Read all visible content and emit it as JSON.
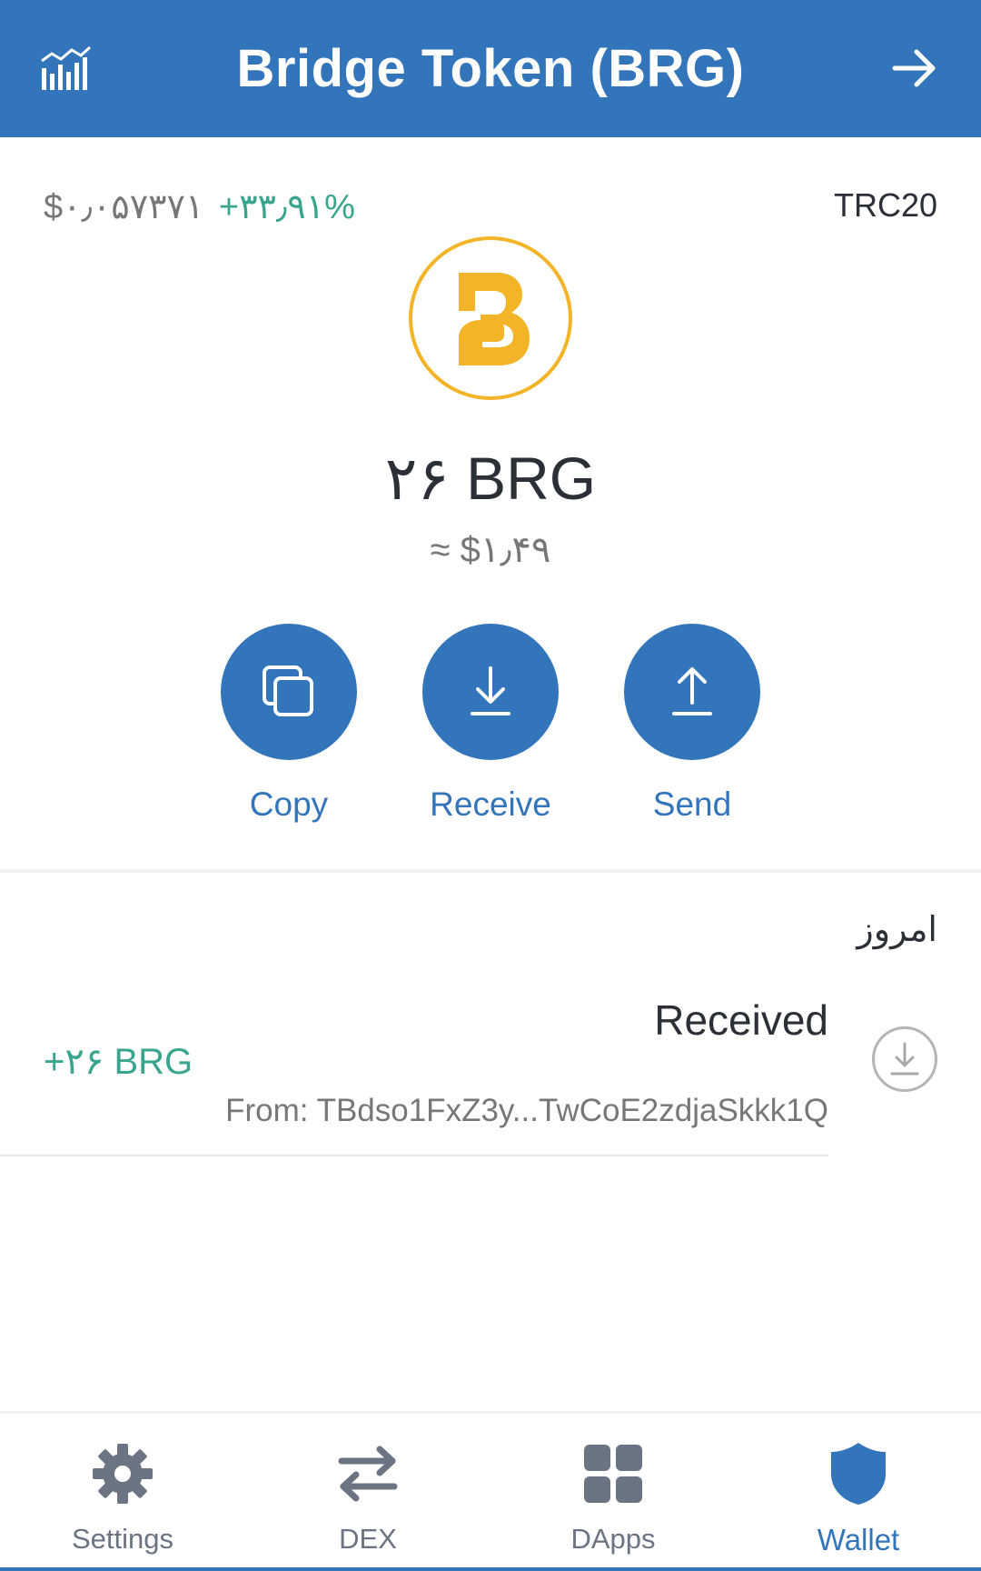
{
  "header": {
    "title": "Bridge Token (BRG)",
    "left_icon": "chart-icon",
    "right_icon": "arrow-right-icon",
    "background": "#3375bb"
  },
  "token": {
    "price": "$۰٫۰۵۷۳۷۱",
    "change": "+۳۳٫۹۱%",
    "network": "TRC20",
    "balance": "۲۶ BRG",
    "fiat_balance": "≈ $۱٫۴۹",
    "logo_color": "#f4b427"
  },
  "actions": [
    {
      "label": "Copy",
      "icon": "copy-icon"
    },
    {
      "label": "Receive",
      "icon": "download-icon"
    },
    {
      "label": "Send",
      "icon": "upload-icon"
    }
  ],
  "transactions": {
    "section_label": "امروز",
    "items": [
      {
        "type": "Received",
        "amount": "+۲۶ BRG",
        "from": "From: TBdso1FxZ3y...TwCoE2zdjaSkkk1Q",
        "icon": "receive-icon"
      }
    ]
  },
  "bottom_nav": {
    "items": [
      {
        "label": "Settings",
        "icon": "gear-icon",
        "active": false
      },
      {
        "label": "DEX",
        "icon": "swap-icon",
        "active": false
      },
      {
        "label": "DApps",
        "icon": "grid-icon",
        "active": false
      },
      {
        "label": "Wallet",
        "icon": "shield-icon",
        "active": true
      }
    ]
  },
  "colors": {
    "accent": "#3375bb",
    "positive": "#3aa58e",
    "muted": "#777777"
  }
}
